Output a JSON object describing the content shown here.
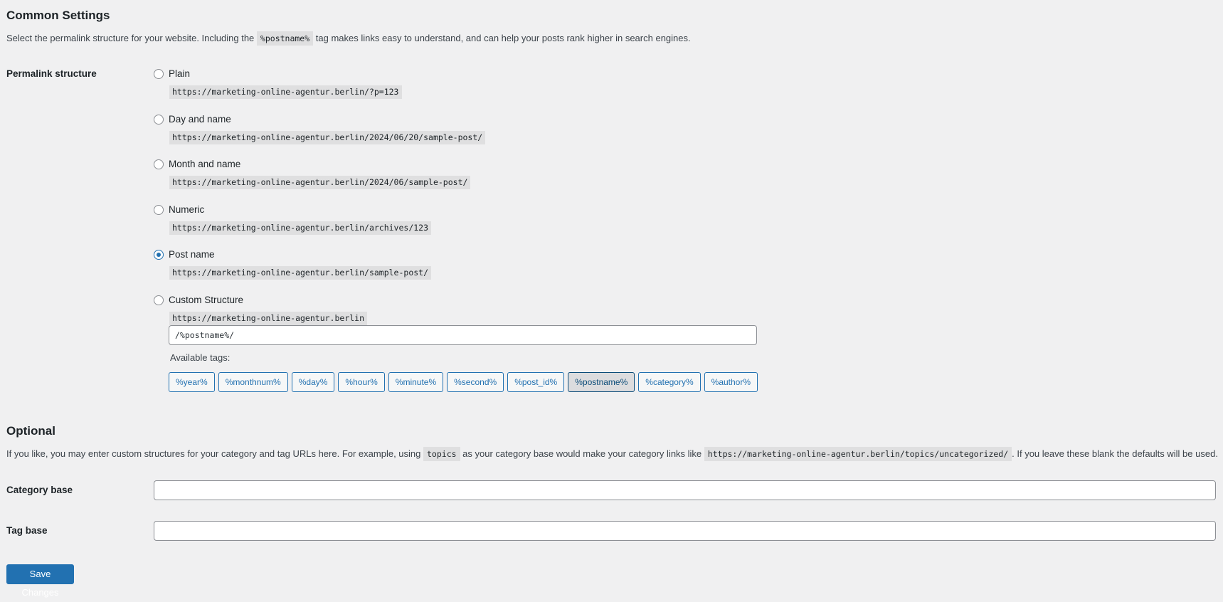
{
  "common": {
    "title": "Common Settings",
    "description_before": "Select the permalink structure for your website. Including the",
    "description_code": "%postname%",
    "description_after": "tag makes links easy to understand, and can help your posts rank higher in search engines."
  },
  "permalink": {
    "label": "Permalink structure",
    "options": [
      {
        "label": "Plain",
        "example": "https://marketing-online-agentur.berlin/?p=123",
        "checked": false
      },
      {
        "label": "Day and name",
        "example": "https://marketing-online-agentur.berlin/2024/06/20/sample-post/",
        "checked": false
      },
      {
        "label": "Month and name",
        "example": "https://marketing-online-agentur.berlin/2024/06/sample-post/",
        "checked": false
      },
      {
        "label": "Numeric",
        "example": "https://marketing-online-agentur.berlin/archives/123",
        "checked": false
      },
      {
        "label": "Post name",
        "example": "https://marketing-online-agentur.berlin/sample-post/",
        "checked": true
      },
      {
        "label": "Custom Structure",
        "example": "https://marketing-online-agentur.berlin",
        "checked": false
      }
    ],
    "custom_value": "/%postname%/",
    "available_tags_label": "Available tags:",
    "tags": [
      {
        "label": "%year%",
        "active": false
      },
      {
        "label": "%monthnum%",
        "active": false
      },
      {
        "label": "%day%",
        "active": false
      },
      {
        "label": "%hour%",
        "active": false
      },
      {
        "label": "%minute%",
        "active": false
      },
      {
        "label": "%second%",
        "active": false
      },
      {
        "label": "%post_id%",
        "active": false
      },
      {
        "label": "%postname%",
        "active": true
      },
      {
        "label": "%category%",
        "active": false
      },
      {
        "label": "%author%",
        "active": false
      }
    ]
  },
  "optional": {
    "title": "Optional",
    "desc_1": "If you like, you may enter custom structures for your category and tag URLs here. For example, using",
    "desc_code_1": "topics",
    "desc_2": "as your category base would make your category links like",
    "desc_code_2": "https://marketing-online-agentur.berlin/topics/uncategorized/",
    "desc_3": ". If you leave these blank the defaults will be used.",
    "category_base_label": "Category base",
    "category_base_value": "",
    "tag_base_label": "Tag base",
    "tag_base_value": ""
  },
  "save_label": "Save Changes",
  "colors": {
    "accent": "#2271b1",
    "background": "#f0f0f1"
  }
}
